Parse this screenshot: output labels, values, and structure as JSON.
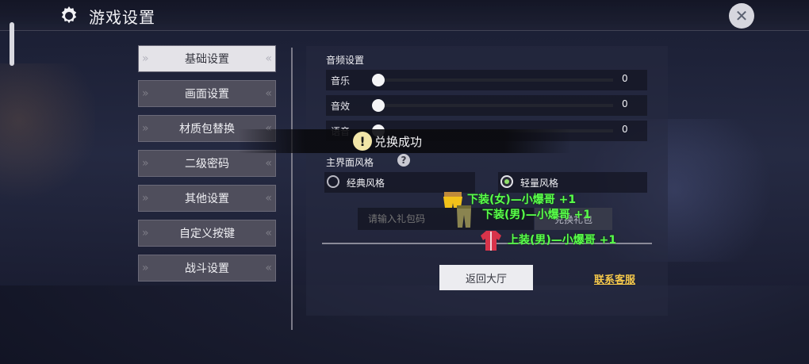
{
  "header": {
    "title": "游戏设置"
  },
  "sidebar": {
    "items": [
      {
        "label": "基础设置",
        "active": true
      },
      {
        "label": "画面设置"
      },
      {
        "label": "材质包替换"
      },
      {
        "label": "二级密码"
      },
      {
        "label": "其他设置"
      },
      {
        "label": "自定义按键"
      },
      {
        "label": "战斗设置"
      }
    ]
  },
  "audio": {
    "section_title": "音频设置",
    "rows": [
      {
        "label": "音乐",
        "value": "0"
      },
      {
        "label": "音效",
        "value": "0"
      },
      {
        "label": "语音",
        "value": "0"
      }
    ]
  },
  "toast": {
    "message": "兑换成功",
    "icon": "exclamation-icon"
  },
  "ui_style": {
    "section_title": "主界面风格",
    "options": [
      {
        "label": "经典风格",
        "selected": false
      },
      {
        "label": "轻量风格",
        "selected": true
      }
    ]
  },
  "gift": {
    "placeholder": "请输入礼包码",
    "button": "兑换礼包"
  },
  "footer": {
    "back_button": "返回大厅",
    "support_link": "联系客服"
  },
  "rewards": [
    {
      "text": "下装(女)—小爆哥 +1"
    },
    {
      "text": "下装(男)—小爆哥 +1"
    },
    {
      "text": "上装(男)—小爆哥 +1"
    }
  ],
  "colors": {
    "reward_text": "#59ff4a",
    "support_link": "#f5c84a",
    "active_radio": "#8fe06a"
  }
}
